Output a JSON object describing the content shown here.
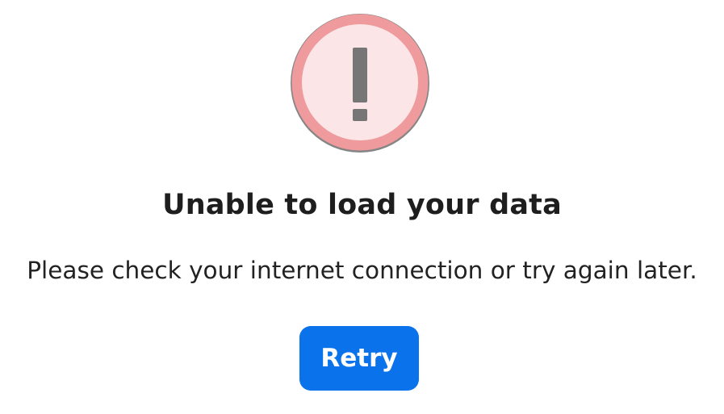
{
  "error": {
    "icon": "exclamation-circle-icon",
    "title": "Unable to load your data",
    "message": "Please check your internet connection or try again later."
  },
  "actions": {
    "retry_label": "Retry"
  },
  "colors": {
    "icon_ring": "#ef9a9c",
    "icon_fill": "#fbe5e6",
    "icon_glyph": "#767676",
    "button_bg": "#0a72ea",
    "button_text": "#ffffff",
    "title_text": "#1e1e1e"
  }
}
